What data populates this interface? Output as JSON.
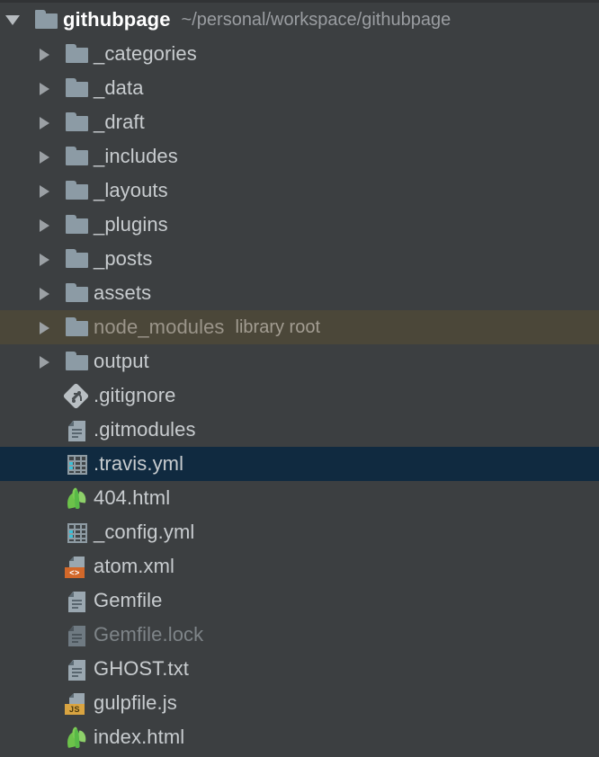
{
  "panel": {
    "name": "project-tool-window",
    "background_color": "#3c3f41",
    "selection_color": "#102a40",
    "excluded_row_color": "#4b4739"
  },
  "tree": {
    "root": {
      "label": "githubpage",
      "path_note": "~/personal/workspace/githubpage",
      "icon": "folder-icon",
      "expanded": true
    },
    "rows": [
      {
        "label": "_categories",
        "note": "",
        "icon": "folder-icon",
        "type": "folder",
        "twisty": "collapsed",
        "state": "normal"
      },
      {
        "label": "_data",
        "note": "",
        "icon": "folder-icon",
        "type": "folder",
        "twisty": "collapsed",
        "state": "normal"
      },
      {
        "label": "_draft",
        "note": "",
        "icon": "folder-icon",
        "type": "folder",
        "twisty": "collapsed",
        "state": "normal"
      },
      {
        "label": "_includes",
        "note": "",
        "icon": "folder-icon",
        "type": "folder",
        "twisty": "collapsed",
        "state": "normal"
      },
      {
        "label": "_layouts",
        "note": "",
        "icon": "folder-icon",
        "type": "folder",
        "twisty": "collapsed",
        "state": "normal"
      },
      {
        "label": "_plugins",
        "note": "",
        "icon": "folder-icon",
        "type": "folder",
        "twisty": "collapsed",
        "state": "normal"
      },
      {
        "label": "_posts",
        "note": "",
        "icon": "folder-icon",
        "type": "folder",
        "twisty": "collapsed",
        "state": "normal"
      },
      {
        "label": "assets",
        "note": "",
        "icon": "folder-icon",
        "type": "folder",
        "twisty": "collapsed",
        "state": "normal"
      },
      {
        "label": "node_modules",
        "note": "library root",
        "icon": "folder-icon",
        "type": "folder",
        "twisty": "collapsed",
        "state": "excluded"
      },
      {
        "label": "output",
        "note": "",
        "icon": "folder-icon",
        "type": "folder",
        "twisty": "collapsed",
        "state": "normal"
      },
      {
        "label": ".gitignore",
        "note": "",
        "icon": "git-file-icon",
        "type": "file",
        "twisty": "none",
        "state": "normal"
      },
      {
        "label": ".gitmodules",
        "note": "",
        "icon": "text-file-icon",
        "type": "file",
        "twisty": "none",
        "state": "normal"
      },
      {
        "label": ".travis.yml",
        "note": "",
        "icon": "yaml-file-icon",
        "type": "file",
        "twisty": "none",
        "state": "selected"
      },
      {
        "label": "404.html",
        "note": "",
        "icon": "html-file-icon",
        "type": "file",
        "twisty": "none",
        "state": "normal"
      },
      {
        "label": "_config.yml",
        "note": "",
        "icon": "yaml-file-icon",
        "type": "file",
        "twisty": "none",
        "state": "normal"
      },
      {
        "label": "atom.xml",
        "note": "",
        "icon": "xml-file-icon",
        "type": "file",
        "twisty": "none",
        "state": "normal"
      },
      {
        "label": "Gemfile",
        "note": "",
        "icon": "text-file-icon",
        "type": "file",
        "twisty": "none",
        "state": "normal"
      },
      {
        "label": "Gemfile.lock",
        "note": "",
        "icon": "text-file-icon",
        "type": "file",
        "twisty": "none",
        "state": "ignored"
      },
      {
        "label": "GHOST.txt",
        "note": "",
        "icon": "text-file-icon",
        "type": "file",
        "twisty": "none",
        "state": "normal"
      },
      {
        "label": "gulpfile.js",
        "note": "",
        "icon": "js-file-icon",
        "type": "file",
        "twisty": "none",
        "state": "normal"
      },
      {
        "label": "index.html",
        "note": "",
        "icon": "html-file-icon",
        "type": "file",
        "twisty": "none",
        "state": "normal"
      }
    ]
  },
  "badges": {
    "xml": "<>",
    "js": "JS"
  }
}
